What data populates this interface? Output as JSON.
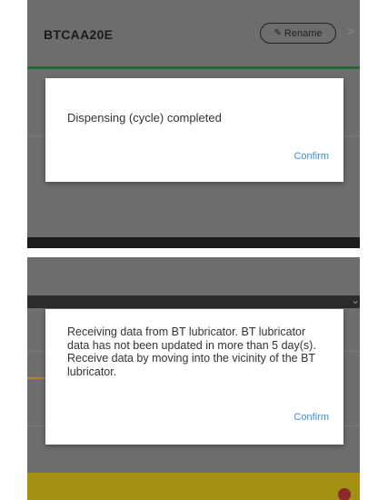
{
  "screen1": {
    "header": {
      "device_name": "BTCAA20E",
      "rename_label": "Rename",
      "chevron": ">"
    },
    "dialog": {
      "message": "Dispensing (cycle) completed",
      "confirm_label": "Confirm"
    }
  },
  "screen2": {
    "dialog": {
      "message": "Receiving data from BT lubricator. BT lubricator data has not been updated in more than 5 day(s). Receive data by moving into the vicinity of the BT lubricator.",
      "confirm_label": "Confirm"
    }
  },
  "colors": {
    "accent_green": "#226b36",
    "confirm_blue": "#3a8ddb",
    "overlay_gray": "#6e6e6e"
  },
  "icons": {
    "rename": "pencil-icon",
    "next": "chevron-right-icon",
    "alert": "alert-dot-icon"
  }
}
